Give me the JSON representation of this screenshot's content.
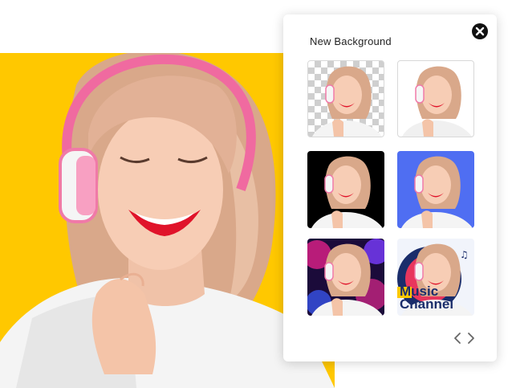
{
  "panel": {
    "title": "New Background",
    "close_icon": "close-icon"
  },
  "colors": {
    "main_background": "#ffc800",
    "panel_background": "#ffffff",
    "dark_option": "#000000",
    "blue_option": "#4f6ef2",
    "music_text": "#1a2d6b"
  },
  "options": [
    {
      "kind": "transparent"
    },
    {
      "kind": "white"
    },
    {
      "kind": "black"
    },
    {
      "kind": "blue"
    },
    {
      "kind": "neon-lights"
    },
    {
      "kind": "music-channel",
      "text_line1": "Music",
      "text_line2": "Channel"
    }
  ],
  "navigation": {
    "prev_icon": "chevron-left-icon",
    "next_icon": "chevron-right-icon"
  }
}
